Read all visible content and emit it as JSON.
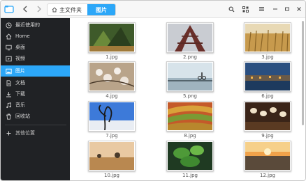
{
  "toolbar": {
    "breadcrumb_home": "主文件夹",
    "breadcrumb_current": "图片"
  },
  "sidebar": {
    "items": [
      {
        "label": "最近使用的",
        "icon": "clock-icon"
      },
      {
        "label": "Home",
        "icon": "home-icon"
      },
      {
        "label": "桌面",
        "icon": "desktop-icon"
      },
      {
        "label": "视频",
        "icon": "video-icon"
      },
      {
        "label": "图片",
        "icon": "picture-icon"
      },
      {
        "label": "文档",
        "icon": "document-icon"
      },
      {
        "label": "下载",
        "icon": "download-icon"
      },
      {
        "label": "音乐",
        "icon": "music-icon"
      },
      {
        "label": "回收站",
        "icon": "trash-icon"
      }
    ],
    "add_location": "其他位置"
  },
  "files": [
    {
      "name": "1.jpg"
    },
    {
      "name": "2.png"
    },
    {
      "name": "3.jpg"
    },
    {
      "name": "4.jpg"
    },
    {
      "name": "5.png"
    },
    {
      "name": "6.jpg"
    },
    {
      "name": "7.jpg"
    },
    {
      "name": "8.jpg"
    },
    {
      "name": "9.jpg"
    },
    {
      "name": "10.jpg"
    },
    {
      "name": "11.jpg"
    },
    {
      "name": "12.jpg"
    }
  ],
  "colors": {
    "accent": "#2ca7f8",
    "sidebar_bg": "#202225"
  }
}
